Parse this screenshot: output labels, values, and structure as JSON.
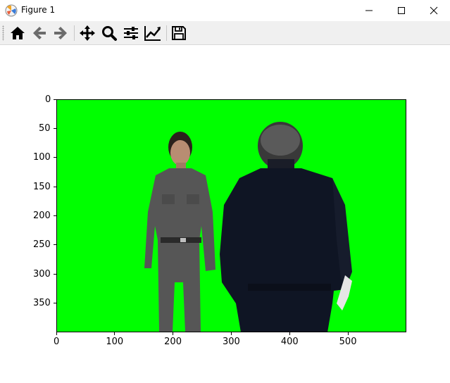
{
  "window": {
    "title": "Figure 1",
    "controls": [
      "minimize",
      "maximize",
      "close"
    ]
  },
  "toolbar": {
    "buttons": [
      {
        "name": "home",
        "icon": "home-icon"
      },
      {
        "name": "back",
        "icon": "arrow-left-icon"
      },
      {
        "name": "forward",
        "icon": "arrow-right-icon"
      },
      {
        "name": "pan",
        "icon": "move-icon"
      },
      {
        "name": "zoom",
        "icon": "magnifier-icon"
      },
      {
        "name": "subplots",
        "icon": "sliders-icon"
      },
      {
        "name": "edit-axis",
        "icon": "line-chart-icon"
      },
      {
        "name": "save",
        "icon": "floppy-disk-icon"
      }
    ]
  },
  "figure": {
    "image_background": "#00ff00",
    "image_description_hidden": true,
    "x_ticks": [
      "0",
      "100",
      "200",
      "300",
      "400",
      "500"
    ],
    "y_ticks": [
      "0",
      "50",
      "100",
      "150",
      "200",
      "250",
      "300",
      "350"
    ],
    "xlim": [
      0,
      600
    ],
    "ylim": [
      400,
      0
    ]
  }
}
